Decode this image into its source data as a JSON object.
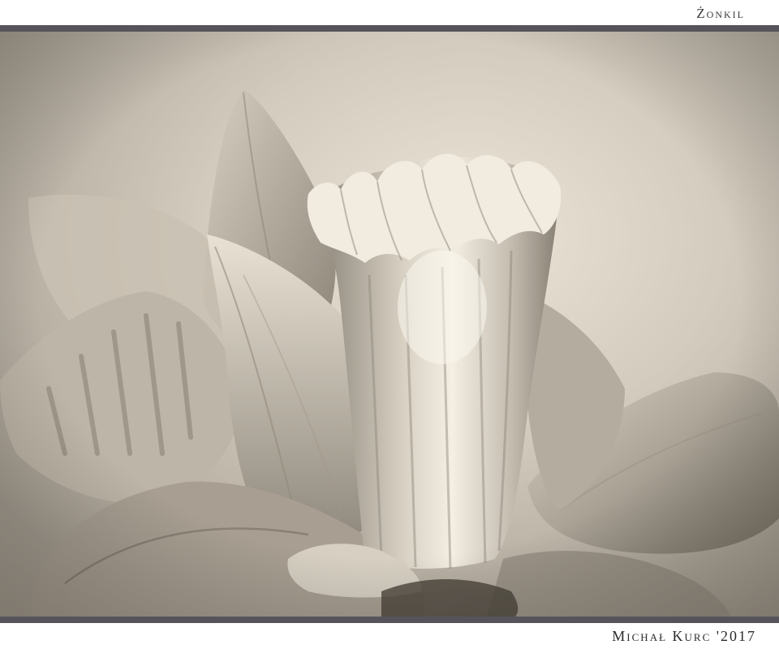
{
  "header": {
    "title": "Żonkil"
  },
  "footer": {
    "signature": "Michał Kurc '2017"
  },
  "photo": {
    "subject": "daffodil-flower",
    "tone": "sepia",
    "colors": {
      "frame_bar": "#56545a",
      "background_light": "#e9e1d3",
      "background_dark": "#a69e92",
      "petal_light": "#f3ede2",
      "petal_shadow": "#6f685e"
    }
  }
}
